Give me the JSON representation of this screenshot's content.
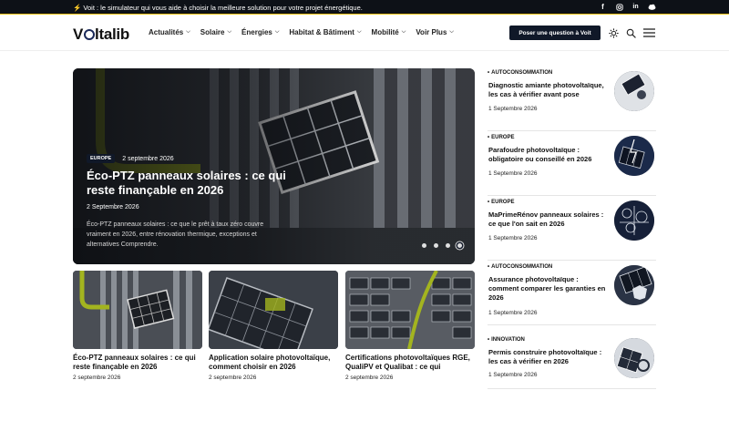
{
  "topbar": {
    "text": "⚡ Voit : le simulateur qui vous aide à choisir la meilleure solution pour votre projet énergétique.",
    "social": [
      "facebook-icon",
      "instagram-icon",
      "linkedin-icon",
      "cloud-icon"
    ]
  },
  "nav": {
    "logo": {
      "pre": "V",
      "post": "ltalib"
    },
    "menu": [
      "Actualités",
      "Solaire",
      "Énergies",
      "Habitat & Bâtiment",
      "Mobilité",
      "Voir Plus"
    ],
    "cta": "Poser une question à Voit",
    "icons": [
      "sun-icon",
      "search-icon",
      "menu-icon"
    ]
  },
  "hero": {
    "category": "EUROPE",
    "date_top": "2 septembre 2026",
    "title": "Éco-PTZ panneaux solaires : ce qui reste finançable en 2026",
    "date": "2 Septembre 2026",
    "excerpt": "Éco-PTZ panneaux solaires : ce que le prêt à taux zéro couvre vraiment en 2026, entre rénovation thermique, exceptions et alternatives Comprendre.",
    "slides": 4,
    "active_slide": 4
  },
  "cards": [
    {
      "title": "Éco-PTZ panneaux solaires : ce qui reste finançable en 2026",
      "date": "2 septembre 2026"
    },
    {
      "title": "Application solaire photovoltaïque, comment choisir en 2026",
      "date": "2 septembre 2026"
    },
    {
      "title": "Certifications photovoltaïques RGE, QualiPV et Qualibat : ce qui",
      "date": "2 septembre 2026"
    }
  ],
  "sidebar": [
    {
      "category": "AUTOCONSOMMATION",
      "title": "Diagnostic amiante photovoltaïque, les cas à vérifier avant pose",
      "date": "1 Septembre 2026"
    },
    {
      "category": "EUROPE",
      "title": "Parafoudre photovoltaïque : obligatoire ou conseillé en 2026",
      "date": "1 Septembre 2026"
    },
    {
      "category": "EUROPE",
      "title": "MaPrimeRénov panneaux solaires : ce que l'on sait en 2026",
      "date": "1 Septembre 2026"
    },
    {
      "category": "AUTOCONSOMMATION",
      "title": "Assurance photovoltaïque : comment comparer les garanties en 2026",
      "date": "1 Septembre 2026"
    },
    {
      "category": "INNOVATION",
      "title": "Permis construire photovoltaïque : les cas à vérifier en 2026",
      "date": "1 Septembre 2026"
    }
  ],
  "colors": {
    "brand_dark": "#101828",
    "accent": "#f5c518"
  }
}
